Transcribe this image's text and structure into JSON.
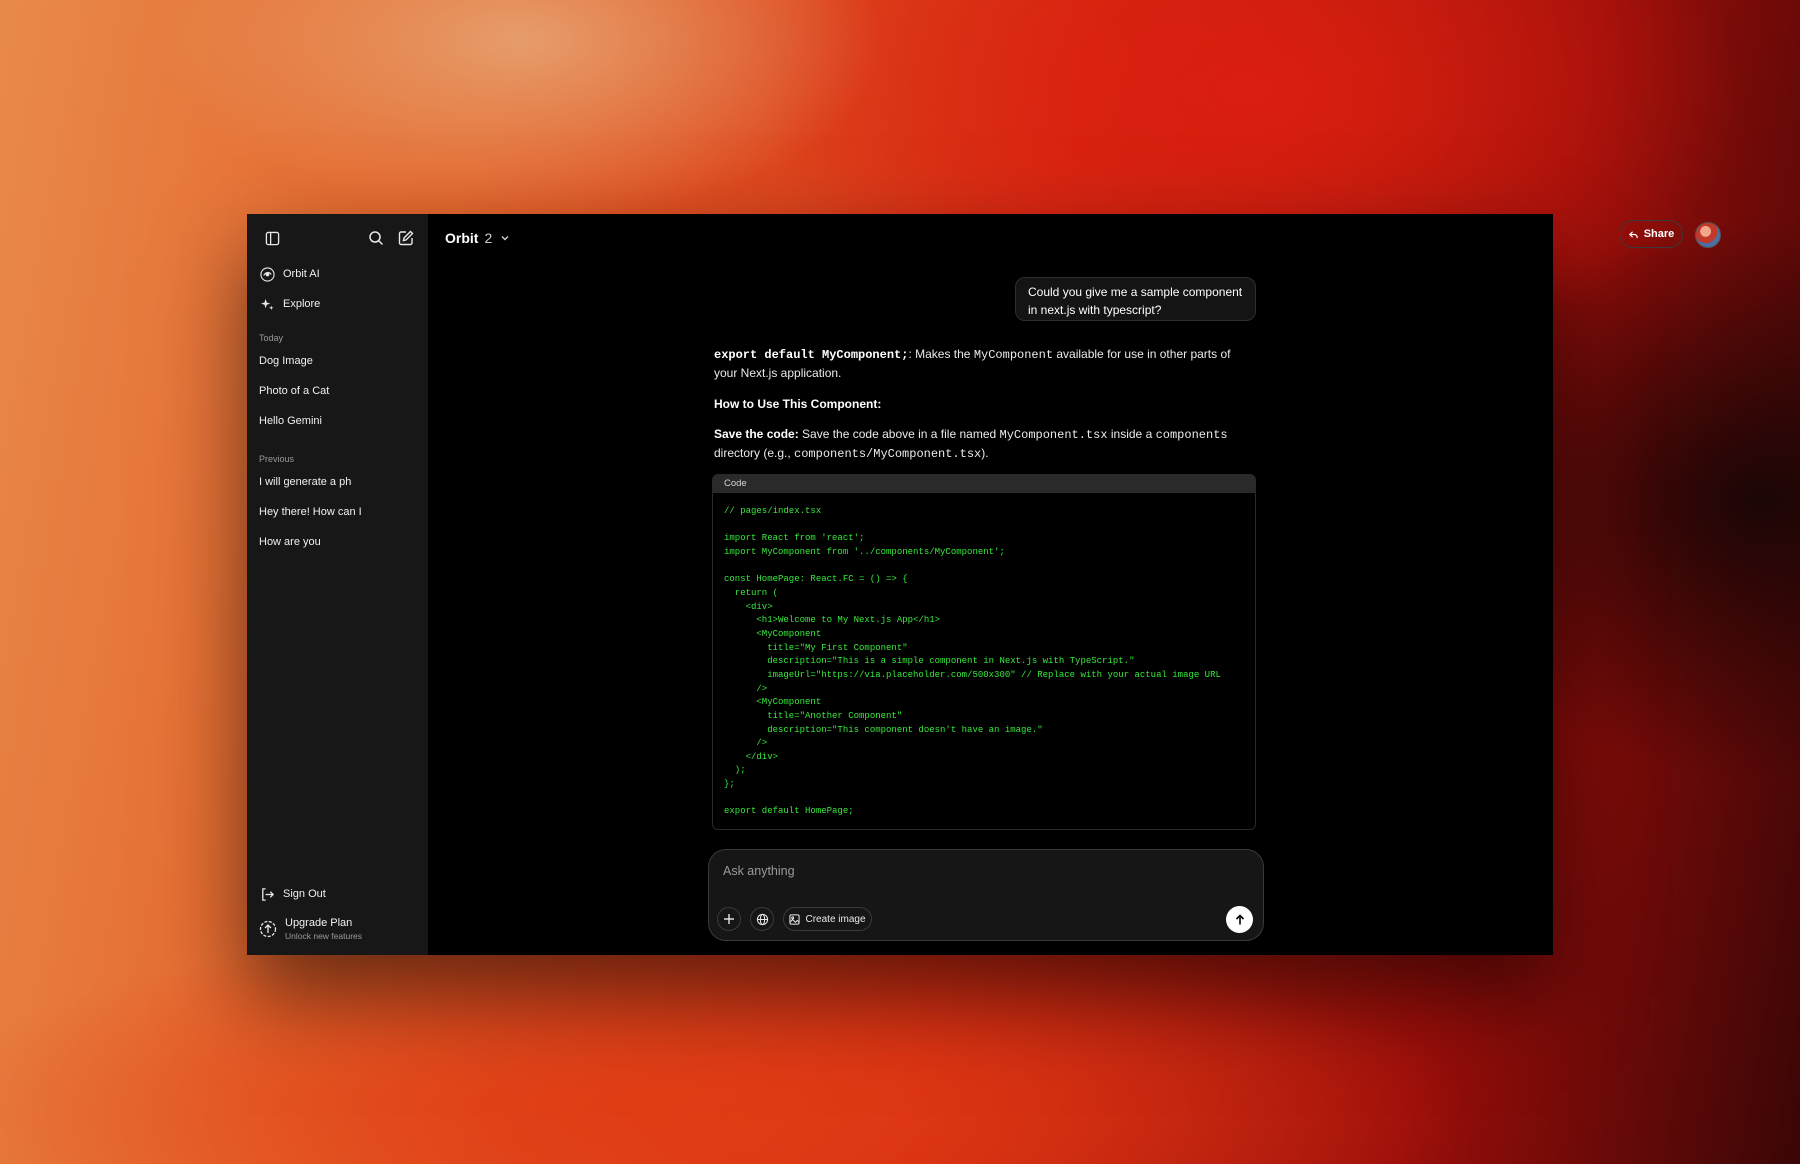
{
  "sidebar": {
    "nav": [
      {
        "label": "Orbit AI",
        "icon": "orbit-logo-icon"
      },
      {
        "label": "Explore",
        "icon": "sparkle-icon"
      }
    ],
    "sections": [
      {
        "title": "Today",
        "chats": [
          "Dog Image",
          "Photo of a Cat",
          "Hello Gemini"
        ]
      },
      {
        "title": "Previous",
        "chats": [
          "I will generate a ph",
          "Hey there! How can I",
          "How are you"
        ]
      }
    ],
    "sign_out": "Sign Out",
    "upgrade": {
      "title": "Upgrade Plan",
      "subtitle": "Unlock new features"
    }
  },
  "topbar": {
    "model": "Orbit",
    "version": "2",
    "share": "Share"
  },
  "conversation": {
    "user_message": "Could you give me a sample component in next.js with typescript?",
    "answer": {
      "p1_code": "export default MyComponent;",
      "p1_a": ": Makes the ",
      "p1_code2": "MyComponent",
      "p1_b": " available for use in other parts of your Next.js application.",
      "heading": "How to Use This Component:",
      "p3_bold": "Save the code:",
      "p3_a": " Save the code above in a file named ",
      "p3_code1": "MyComponent.tsx",
      "p3_b": " inside a ",
      "p3_code2": "components",
      "p3_c": " directory (e.g., ",
      "p3_code3": "components/MyComponent.tsx",
      "p3_d": ")."
    },
    "code_block": {
      "label": "Code",
      "code": "// pages/index.tsx\n\nimport React from 'react';\nimport MyComponent from '../components/MyComponent';\n\nconst HomePage: React.FC = () => {\n  return (\n    <div>\n      <h1>Welcome to My Next.js App</h1>\n      <MyComponent\n        title=\"My First Component\"\n        description=\"This is a simple component in Next.js with TypeScript.\"\n        imageUrl=\"https://via.placeholder.com/500x300\" // Replace with your actual image URL\n      />\n      <MyComponent\n        title=\"Another Component\"\n        description=\"This component doesn't have an image.\"\n      />\n    </div>\n  );\n};\n\nexport default HomePage;"
    }
  },
  "composer": {
    "placeholder": "Ask anything",
    "create_image": "Create image"
  },
  "colors": {
    "code_text": "#38e83c",
    "sidebar_bg": "#171717",
    "main_bg": "#000000"
  }
}
